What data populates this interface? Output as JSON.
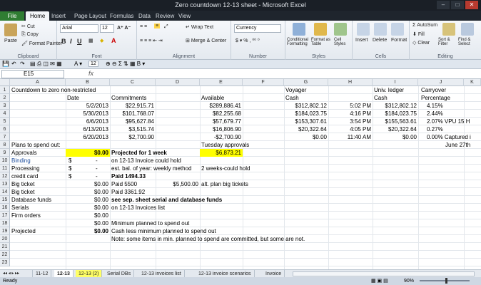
{
  "window": {
    "title": "Zero countdown 12-13 sheet - Microsoft Excel"
  },
  "ribbon_tabs": [
    "File",
    "Home",
    "Insert",
    "Page Layout",
    "Formulas",
    "Data",
    "Review",
    "View"
  ],
  "ribbon": {
    "paste": "Paste",
    "cut": "Cut",
    "copy": "Copy",
    "format_painter": "Format Painter",
    "font_name": "Arial",
    "font_size": "12",
    "wrap_text": "Wrap Text",
    "merge_center": "Merge & Center",
    "number_format": "Currency",
    "conditional": "Conditional Formatting",
    "format_table": "Format as Table",
    "cell_styles": "Cell Styles",
    "insert": "Insert",
    "delete": "Delete",
    "format": "Format",
    "autosum": "AutoSum",
    "fill": "Fill",
    "clear": "Clear",
    "sort_filter": "Sort & Filter",
    "find_select": "Find & Select",
    "groups": [
      "Clipboard",
      "Font",
      "Alignment",
      "Number",
      "Styles",
      "Cells",
      "Editing"
    ]
  },
  "qat": {
    "font_size": "12"
  },
  "formula_bar": {
    "name_box": "E15",
    "fx": "fx"
  },
  "columns": [
    "A",
    "B",
    "C",
    "D",
    "E",
    "F",
    "G",
    "H",
    "I",
    "J",
    "K"
  ],
  "rows": [
    "1",
    "2",
    "3",
    "4",
    "5",
    "6",
    "7",
    "8",
    "9",
    "10",
    "11",
    "12",
    "13",
    "14",
    "15",
    "16",
    "17",
    "18",
    "19",
    "20",
    "21",
    "22",
    "23"
  ],
  "cells": {
    "A1": "Countdown to zero non-restricted",
    "C1": "",
    "G1": "Voyager",
    "I1": "Univ. ledger",
    "J1": "Carryover",
    "B2": "Date",
    "C2": "Commitments",
    "E2": "Available",
    "G2": "Cash",
    "I2": "Cash",
    "J2": "Percentage",
    "B3": "5/2/2013",
    "C3": "$22,915.71",
    "E3": "$289,886.41",
    "G3": "$312,802.12",
    "H3": "5:02 PM",
    "I3": "$312,802.12",
    "J3": "4.15%",
    "B4": "5/30/2013",
    "C4": "$101,768.07",
    "E4": "$82,255.68",
    "G4": "$184,023.75",
    "H4": "4:16 PM",
    "I4": "$184,023.75",
    "J4": "2.44%",
    "B5": "6/6/2013",
    "C5": "$95,627.84",
    "E5": "$57,679.77",
    "G5": "$153,307.61",
    "H5": "3:54 PM",
    "I5": "$155,563.61",
    "J5": "2.07% VPU 15 H",
    "B6": "6/13/2013",
    "C6": "$3,515.74",
    "E6": "$16,806.90",
    "G6": "$20,322.64",
    "H6": "4:05 PM",
    "I6": "$20,322.64",
    "J6": "0.27%",
    "B7": "6/20/2013",
    "C7": "$2,700.90",
    "E7": "-$2,700.90",
    "G7": "$0.00",
    "H7": "11:40 AM",
    "I7": "$0.00",
    "J7": "0.00% Captured i",
    "A8": "Plans to spend out:",
    "E8": "Tuesday approvals",
    "J8": "June 27th",
    "A9": "Approvals",
    "B9": "$0.00",
    "C9": "Projected for 1 week",
    "E9": "$6,873.21",
    "A10": "Binding",
    "B10a": "$",
    "B10": "-",
    "C10": "on 12-13 Invoice could hold",
    "A11": "Processing",
    "B11a": "$",
    "B11": "-",
    "C11": "est. bal. of year: weekly method",
    "E11": "2 weeks-could hold",
    "A12": "credit card",
    "B12a": "$",
    "B12": "-",
    "C12": "Paid 1494.33",
    "A13": "Big ticket",
    "B13": "$0.00",
    "C13": "Paid 5500",
    "D13": "$5,500.00",
    "E13": "alt. plan big tickets",
    "A14": "Big ticket",
    "B14": "$0.00",
    "C14": "Paid 3361.92",
    "A15": "Database funds",
    "B15": "$0.00",
    "C15": "see sep. sheet serial and database funds",
    "A16": "Serials",
    "B16": "$0.00",
    "C16": "on 12-13 Invoices list",
    "A17": "Firm orders",
    "B17": "$0.00",
    "B18": "$0.00",
    "C18": "Minimum planned to spend out",
    "A19": "Projected",
    "B19": "$0.00",
    "C19": "Cash less minimum planned to spend out",
    "C20": "Note: some items in min. planned to spend are committed, but some are not."
  },
  "sheet_tabs": [
    "11-12",
    "12-13",
    "12-13 (2)",
    "Serial DBs",
    "12-13 invoices list",
    "12-13 invoice scenarios",
    "Invoice"
  ],
  "status": {
    "ready": "Ready",
    "zoom": "90%"
  },
  "colors": {
    "highlight": "#ffff00",
    "file_tab": "#2f7d32",
    "link_blue": "#1f4e9e"
  }
}
